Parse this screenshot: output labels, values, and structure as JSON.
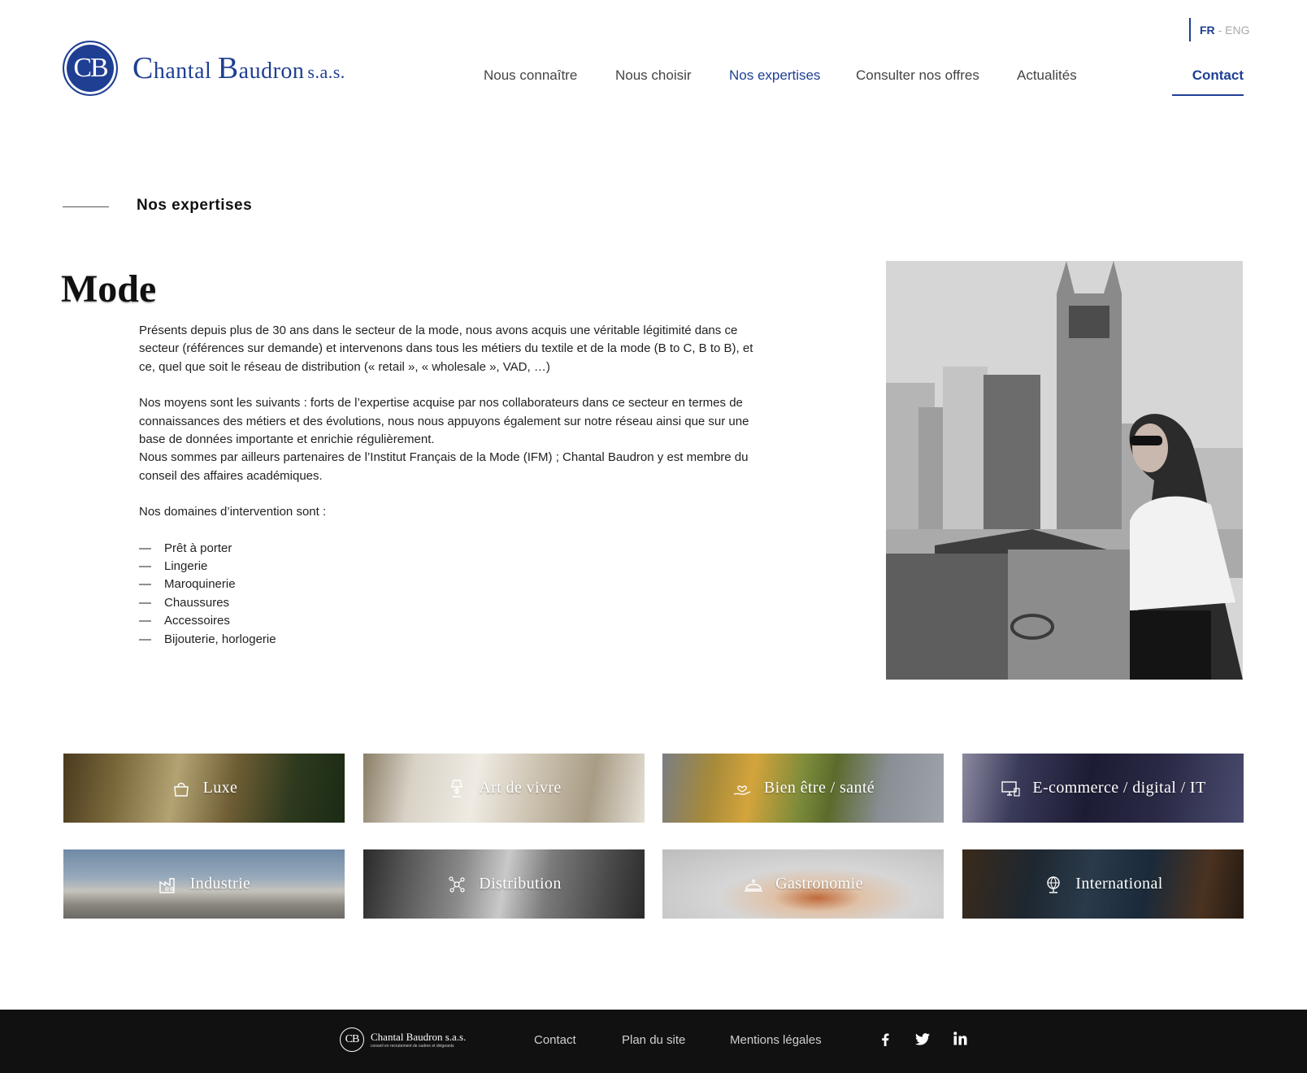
{
  "header": {
    "logo_initials": "CB",
    "logo_name_c": "C",
    "logo_name_1": "hantal ",
    "logo_name_b": "B",
    "logo_name_2": "audron",
    "logo_sas": "s.a.s.",
    "lang_active": "FR",
    "lang_sep": " - ",
    "lang_other": "ENG",
    "nav": [
      {
        "label": "Nous connaître",
        "active": false
      },
      {
        "label": "Nous choisir",
        "active": false
      },
      {
        "label": "Nos expertises",
        "active": true
      },
      {
        "label": "Consulter nos offres",
        "active": false
      },
      {
        "label": "Actualités",
        "active": false
      }
    ],
    "contact_label": "Contact",
    "accent_color": "#1f3f93"
  },
  "section": {
    "title": "Nos expertises"
  },
  "main": {
    "heading": "Mode",
    "paragraphs": [
      "Présents depuis plus de 30 ans dans le secteur de la mode, nous avons acquis une véritable légitimité dans ce secteur (références sur demande) et intervenons dans tous les métiers du textile et de la mode (B to C, B to B), et ce, quel que soit le réseau de distribution (« retail », « wholesale », VAD, …)",
      "Nos moyens sont les suivants : forts de l’expertise acquise par nos collaborateurs dans ce secteur en termes de connaissances des métiers et des évolutions, nous nous appuyons également sur notre réseau ainsi que sur une base de données importante et enrichie régulièrement.",
      "Nous sommes par ailleurs partenaires de l’Institut Français de la Mode (IFM) ; Chantal Baudron y est membre du conseil des affaires académiques.",
      "Nos domaines d’intervention sont :"
    ],
    "list_dash": "—",
    "domains": [
      "Prêt à porter",
      "Lingerie",
      "Maroquinerie",
      "Chaussures",
      "Accessoires",
      "Bijouterie, horlogerie"
    ]
  },
  "tiles": [
    {
      "label": "Luxe",
      "icon": "handbag-icon"
    },
    {
      "label": "Art de vivre",
      "icon": "lamp-icon"
    },
    {
      "label": "Bien être / santé",
      "icon": "hand-heart-icon"
    },
    {
      "label": "E-commerce / digital / IT",
      "icon": "computer-icon"
    },
    {
      "label": "Industrie",
      "icon": "factory-icon"
    },
    {
      "label": "Distribution",
      "icon": "network-icon"
    },
    {
      "label": "Gastronomie",
      "icon": "cloche-icon"
    },
    {
      "label": "International",
      "icon": "globe-icon"
    }
  ],
  "footer": {
    "logo_initials": "CB",
    "logo_name": "Chantal Baudron s.a.s.",
    "logo_tagline": "conseil en recrutement de cadres et dirigeants",
    "links": [
      "Contact",
      "Plan du site",
      "Mentions légales"
    ],
    "social": [
      "facebook-icon",
      "twitter-icon",
      "linkedin-icon"
    ],
    "social_glyphs": [
      "f",
      "🐦",
      "in"
    ]
  }
}
